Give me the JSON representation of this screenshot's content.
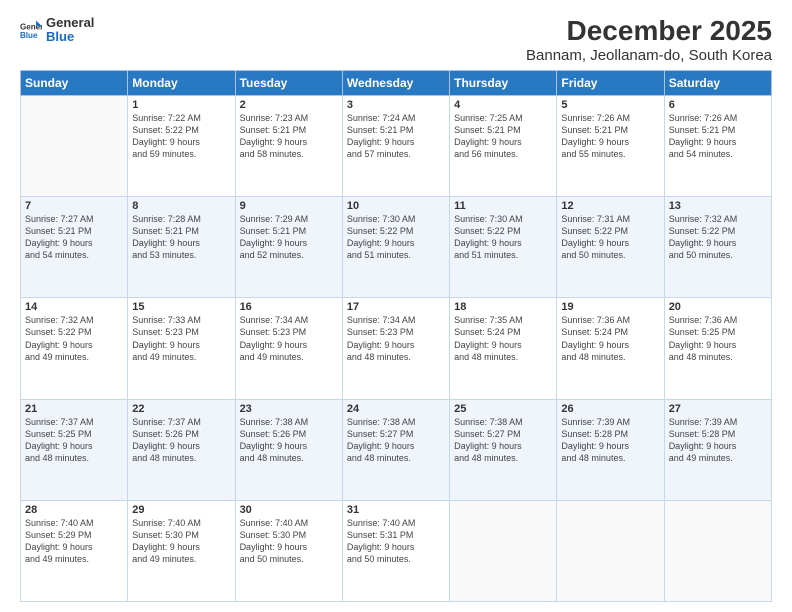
{
  "logo": {
    "general": "General",
    "blue": "Blue"
  },
  "title": "December 2025",
  "subtitle": "Bannam, Jeollanam-do, South Korea",
  "weekdays": [
    "Sunday",
    "Monday",
    "Tuesday",
    "Wednesday",
    "Thursday",
    "Friday",
    "Saturday"
  ],
  "weeks": [
    [
      {
        "day": "",
        "info": ""
      },
      {
        "day": "1",
        "info": "Sunrise: 7:22 AM\nSunset: 5:22 PM\nDaylight: 9 hours\nand 59 minutes."
      },
      {
        "day": "2",
        "info": "Sunrise: 7:23 AM\nSunset: 5:21 PM\nDaylight: 9 hours\nand 58 minutes."
      },
      {
        "day": "3",
        "info": "Sunrise: 7:24 AM\nSunset: 5:21 PM\nDaylight: 9 hours\nand 57 minutes."
      },
      {
        "day": "4",
        "info": "Sunrise: 7:25 AM\nSunset: 5:21 PM\nDaylight: 9 hours\nand 56 minutes."
      },
      {
        "day": "5",
        "info": "Sunrise: 7:26 AM\nSunset: 5:21 PM\nDaylight: 9 hours\nand 55 minutes."
      },
      {
        "day": "6",
        "info": "Sunrise: 7:26 AM\nSunset: 5:21 PM\nDaylight: 9 hours\nand 54 minutes."
      }
    ],
    [
      {
        "day": "7",
        "info": "Sunrise: 7:27 AM\nSunset: 5:21 PM\nDaylight: 9 hours\nand 54 minutes."
      },
      {
        "day": "8",
        "info": "Sunrise: 7:28 AM\nSunset: 5:21 PM\nDaylight: 9 hours\nand 53 minutes."
      },
      {
        "day": "9",
        "info": "Sunrise: 7:29 AM\nSunset: 5:21 PM\nDaylight: 9 hours\nand 52 minutes."
      },
      {
        "day": "10",
        "info": "Sunrise: 7:30 AM\nSunset: 5:22 PM\nDaylight: 9 hours\nand 51 minutes."
      },
      {
        "day": "11",
        "info": "Sunrise: 7:30 AM\nSunset: 5:22 PM\nDaylight: 9 hours\nand 51 minutes."
      },
      {
        "day": "12",
        "info": "Sunrise: 7:31 AM\nSunset: 5:22 PM\nDaylight: 9 hours\nand 50 minutes."
      },
      {
        "day": "13",
        "info": "Sunrise: 7:32 AM\nSunset: 5:22 PM\nDaylight: 9 hours\nand 50 minutes."
      }
    ],
    [
      {
        "day": "14",
        "info": "Sunrise: 7:32 AM\nSunset: 5:22 PM\nDaylight: 9 hours\nand 49 minutes."
      },
      {
        "day": "15",
        "info": "Sunrise: 7:33 AM\nSunset: 5:23 PM\nDaylight: 9 hours\nand 49 minutes."
      },
      {
        "day": "16",
        "info": "Sunrise: 7:34 AM\nSunset: 5:23 PM\nDaylight: 9 hours\nand 49 minutes."
      },
      {
        "day": "17",
        "info": "Sunrise: 7:34 AM\nSunset: 5:23 PM\nDaylight: 9 hours\nand 48 minutes."
      },
      {
        "day": "18",
        "info": "Sunrise: 7:35 AM\nSunset: 5:24 PM\nDaylight: 9 hours\nand 48 minutes."
      },
      {
        "day": "19",
        "info": "Sunrise: 7:36 AM\nSunset: 5:24 PM\nDaylight: 9 hours\nand 48 minutes."
      },
      {
        "day": "20",
        "info": "Sunrise: 7:36 AM\nSunset: 5:25 PM\nDaylight: 9 hours\nand 48 minutes."
      }
    ],
    [
      {
        "day": "21",
        "info": "Sunrise: 7:37 AM\nSunset: 5:25 PM\nDaylight: 9 hours\nand 48 minutes."
      },
      {
        "day": "22",
        "info": "Sunrise: 7:37 AM\nSunset: 5:26 PM\nDaylight: 9 hours\nand 48 minutes."
      },
      {
        "day": "23",
        "info": "Sunrise: 7:38 AM\nSunset: 5:26 PM\nDaylight: 9 hours\nand 48 minutes."
      },
      {
        "day": "24",
        "info": "Sunrise: 7:38 AM\nSunset: 5:27 PM\nDaylight: 9 hours\nand 48 minutes."
      },
      {
        "day": "25",
        "info": "Sunrise: 7:38 AM\nSunset: 5:27 PM\nDaylight: 9 hours\nand 48 minutes."
      },
      {
        "day": "26",
        "info": "Sunrise: 7:39 AM\nSunset: 5:28 PM\nDaylight: 9 hours\nand 48 minutes."
      },
      {
        "day": "27",
        "info": "Sunrise: 7:39 AM\nSunset: 5:28 PM\nDaylight: 9 hours\nand 49 minutes."
      }
    ],
    [
      {
        "day": "28",
        "info": "Sunrise: 7:40 AM\nSunset: 5:29 PM\nDaylight: 9 hours\nand 49 minutes."
      },
      {
        "day": "29",
        "info": "Sunrise: 7:40 AM\nSunset: 5:30 PM\nDaylight: 9 hours\nand 49 minutes."
      },
      {
        "day": "30",
        "info": "Sunrise: 7:40 AM\nSunset: 5:30 PM\nDaylight: 9 hours\nand 50 minutes."
      },
      {
        "day": "31",
        "info": "Sunrise: 7:40 AM\nSunset: 5:31 PM\nDaylight: 9 hours\nand 50 minutes."
      },
      {
        "day": "",
        "info": ""
      },
      {
        "day": "",
        "info": ""
      },
      {
        "day": "",
        "info": ""
      }
    ]
  ]
}
